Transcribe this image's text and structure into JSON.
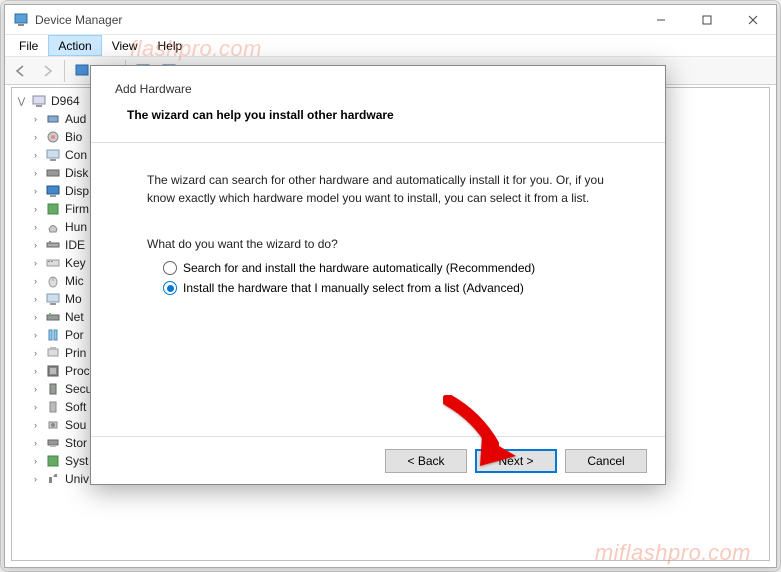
{
  "window": {
    "title": "Device Manager",
    "menu": {
      "file": "File",
      "action": "Action",
      "view": "View",
      "help": "Help"
    },
    "controls": {
      "min": "—",
      "max": "▢",
      "close": "✕"
    }
  },
  "tree": {
    "root": "D964",
    "items": [
      "Aud",
      "Bio",
      "Con",
      "Disk",
      "Disp",
      "Firm",
      "Hun",
      "IDE",
      "Key",
      "Mic",
      "Mo",
      "Net",
      "Por",
      "Prin",
      "Proc",
      "Secu",
      "Soft",
      "Sou",
      "Stor",
      "Syst",
      "Univ"
    ]
  },
  "dialog": {
    "title": "Add Hardware",
    "subtitle": "The wizard can help you install other hardware",
    "body": "The wizard can search for other hardware and automatically install it for you. Or, if you know exactly which hardware model you want to install, you can select it from a list.",
    "question": "What do you want the wizard to do?",
    "option_auto": "Search for and install the hardware automatically (Recommended)",
    "option_manual": "Install the hardware that I manually select from a list (Advanced)",
    "back": "< Back",
    "next": "Next >",
    "cancel": "Cancel"
  },
  "watermarks": {
    "w1": "flashpro.com",
    "w2": "miflashpro.com"
  }
}
